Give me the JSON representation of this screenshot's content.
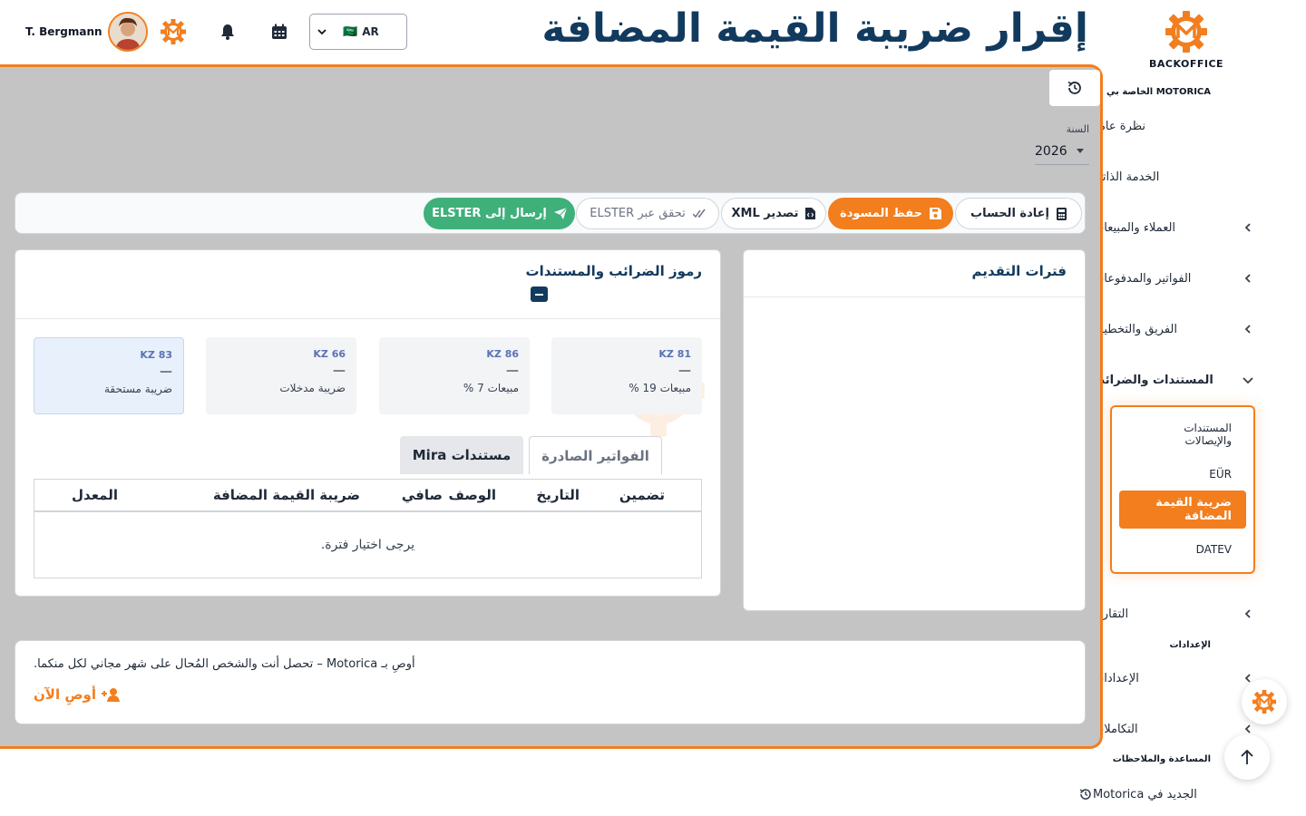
{
  "app": {
    "brand": "BACKOFFICE",
    "page_title": "إقرار ضريبة القيمة المضافة"
  },
  "topbar": {
    "user_name": "T. Bergmann",
    "language": {
      "flag": "🇸🇦",
      "code": "AR"
    },
    "icons": [
      "motorica-gear-icon",
      "bell-icon",
      "calendar-icon"
    ]
  },
  "sidebar": {
    "sections": {
      "mine": "MOTORICA الخاصة بي",
      "settings": "الإعدادات",
      "help": "المساعدة والملاحظات"
    },
    "items": {
      "overview": "نظرة عامة",
      "self_service": "الخدمة الذاتية",
      "customers_sales": "العملاء والمبيعات",
      "invoices_payments": "الفواتير والمدفوعات",
      "team_planning": "الفريق والتخطيط",
      "documents_taxes": "المستندات والضرائب",
      "reports": "التقارير",
      "settings": "الإعدادات",
      "integrations": "التكاملات",
      "whats_new": "الجديد في Motorica"
    },
    "submenu": {
      "documents_receipts": "المستندات والإيصالات",
      "eur": "EÜR",
      "vat": "ضريبة القيمة المضافة",
      "datev": "DATEV"
    }
  },
  "filters": {
    "year_label": "السنة",
    "year_value": "2026"
  },
  "toolbar": {
    "recalculate": "إعادة الحساب",
    "save_draft": "حفظ المسودة",
    "export_xml": "تصدير XML",
    "validate_elster": "تحقق عبر ELSTER",
    "send_elster": "إرسال إلى ELSTER"
  },
  "periods": {
    "title": "فترات التقديم"
  },
  "tax_codes": {
    "title": "رموز الضرائب والمستندات",
    "cards": [
      {
        "code": "KZ 81",
        "value": "—",
        "desc": "مبيعات 19 %"
      },
      {
        "code": "KZ 86",
        "value": "—",
        "desc": "مبيعات 7 %"
      },
      {
        "code": "KZ 66",
        "value": "—",
        "desc": "ضريبة مدخلات"
      },
      {
        "code": "KZ 83",
        "value": "—",
        "desc": "ضريبة مستحقة"
      }
    ],
    "tabs": {
      "issued_invoices": "الفواتير الصادرة",
      "mira_docs": "مستندات Mira"
    },
    "table": {
      "columns": {
        "include": "تضمين",
        "date": "التاريخ",
        "description": "الوصف",
        "net": "صافي",
        "vat": "ضريبة القيمة المضافة",
        "rate": "المعدل"
      },
      "empty_message": "يرجى اختيار فترة."
    }
  },
  "referral": {
    "text": "أوصِ بـ Motorica – تحصل أنت والشخص المُحال على شهر مجاني لكل منكما.",
    "cta": "أوصِ الآن"
  },
  "colors": {
    "accent": "#f27e1e",
    "title": "#123a5e",
    "success": "#3fb07a",
    "overlay": "#c4c4c4"
  }
}
